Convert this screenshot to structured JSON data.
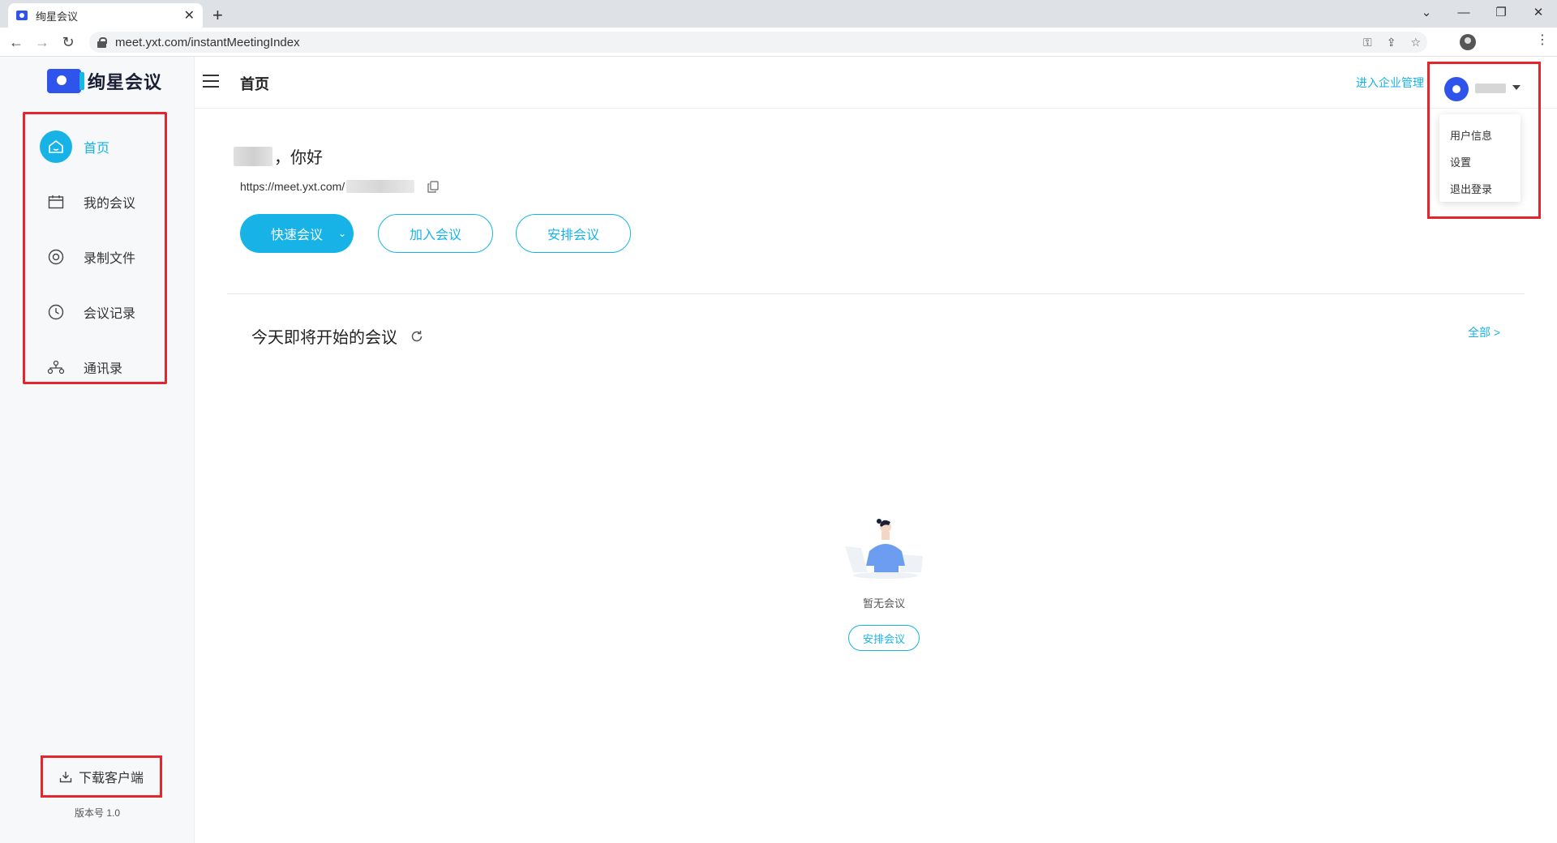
{
  "browser": {
    "tab_title": "绚星会议",
    "tab_close": "✕",
    "new_tab": "+",
    "url": "meet.yxt.com/instantMeetingIndex",
    "controls": {
      "collapse": "⌄",
      "minimize": "—",
      "restore": "❐",
      "close": "✕"
    }
  },
  "app": {
    "logo_text": "绚星会议",
    "nav": [
      {
        "label": "首页",
        "icon": "home-icon",
        "active": true
      },
      {
        "label": "我的会议",
        "icon": "calendar-icon",
        "active": false
      },
      {
        "label": "录制文件",
        "icon": "record-icon",
        "active": false
      },
      {
        "label": "会议记录",
        "icon": "clock-icon",
        "active": false
      },
      {
        "label": "通讯录",
        "icon": "contacts-icon",
        "active": false
      }
    ],
    "download_label": "下载客户端",
    "version": "版本号 1.0",
    "accent_color": "#17b3e6",
    "brand_color": "#2f54eb",
    "highlight_color": "#e3262d"
  },
  "header": {
    "page_title": "首页",
    "admin_link": "进入企业管理",
    "user_menu": [
      "用户信息",
      "设置",
      "退出登录"
    ]
  },
  "main": {
    "greeting_suffix": "，你好",
    "meeting_link_prefix": "https://meet.yxt.com/",
    "buttons": {
      "quick": "快速会议",
      "join": "加入会议",
      "schedule": "安排会议"
    },
    "section_title": "今天即将开始的会议",
    "all_link": "全部 >",
    "empty_text": "暂无会议",
    "empty_button": "安排会议"
  }
}
